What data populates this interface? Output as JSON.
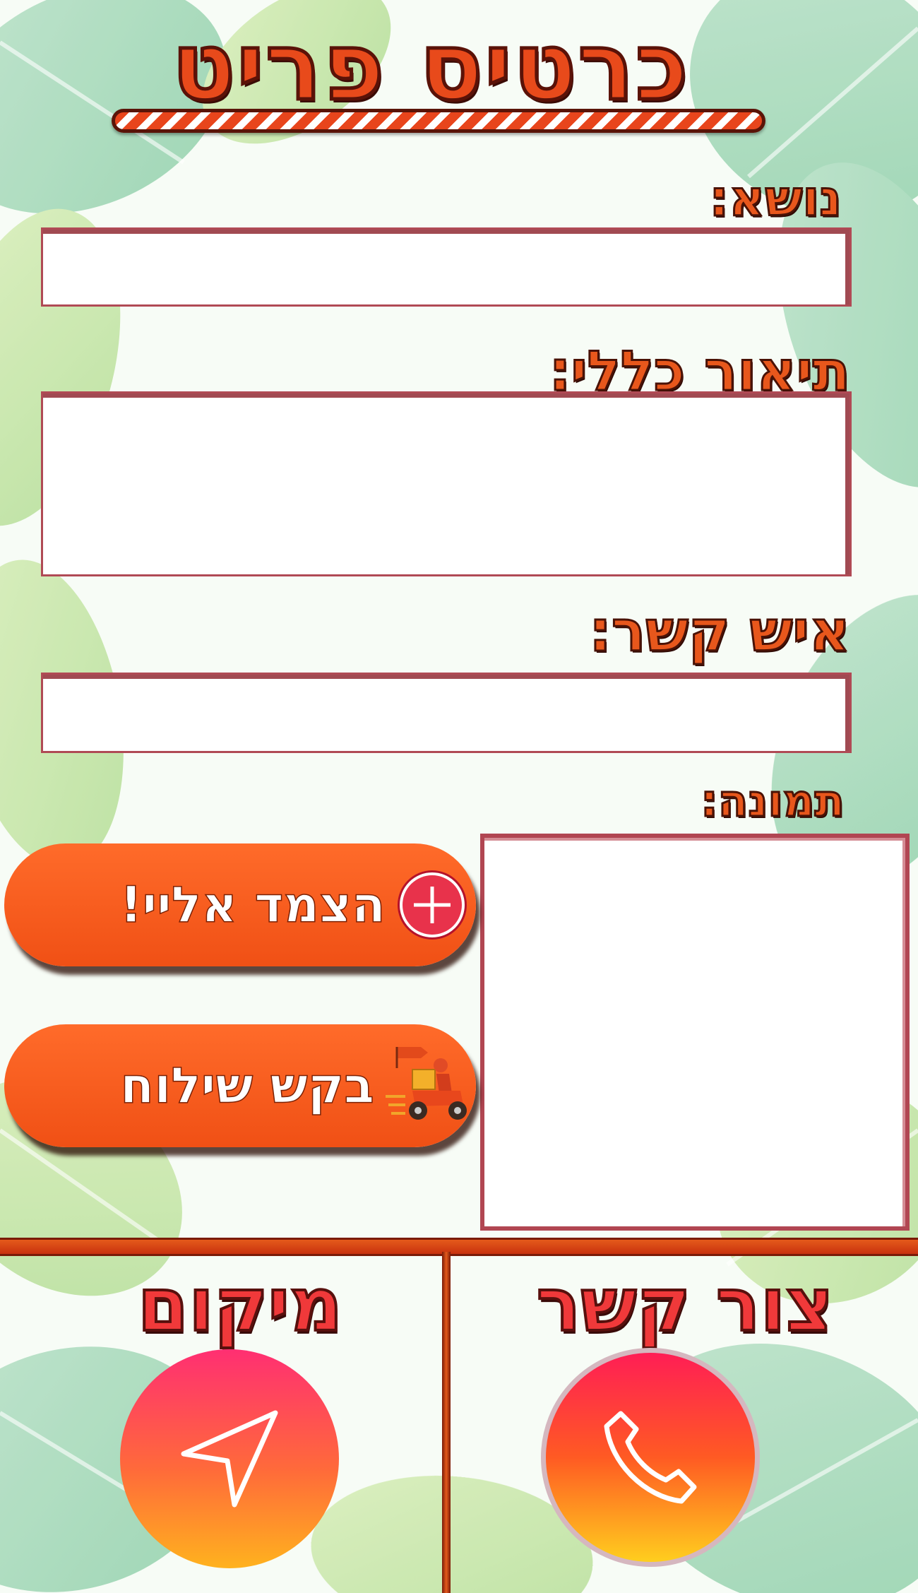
{
  "header": {
    "title": "כרטיס פריט"
  },
  "form": {
    "subject_label": "נושא:",
    "subject_value": "",
    "description_label": "תיאור כללי:",
    "description_value": "",
    "contact_label": "איש קשר:",
    "contact_value": "",
    "image_label": "תמונה:"
  },
  "actions": {
    "attach_label": "הצמד אליי!",
    "attach_icon": "plus-circle-icon",
    "delivery_label": "בקש שילוח",
    "delivery_icon": "delivery-scooter-icon"
  },
  "footer": {
    "location_label": "מיקום",
    "location_icon": "navigation-arrow-icon",
    "contact_label": "צור קשר",
    "contact_icon": "phone-icon"
  },
  "colors": {
    "accent": "#f05015",
    "title_stroke": "#5a1208",
    "field_border": "#b04a55"
  }
}
